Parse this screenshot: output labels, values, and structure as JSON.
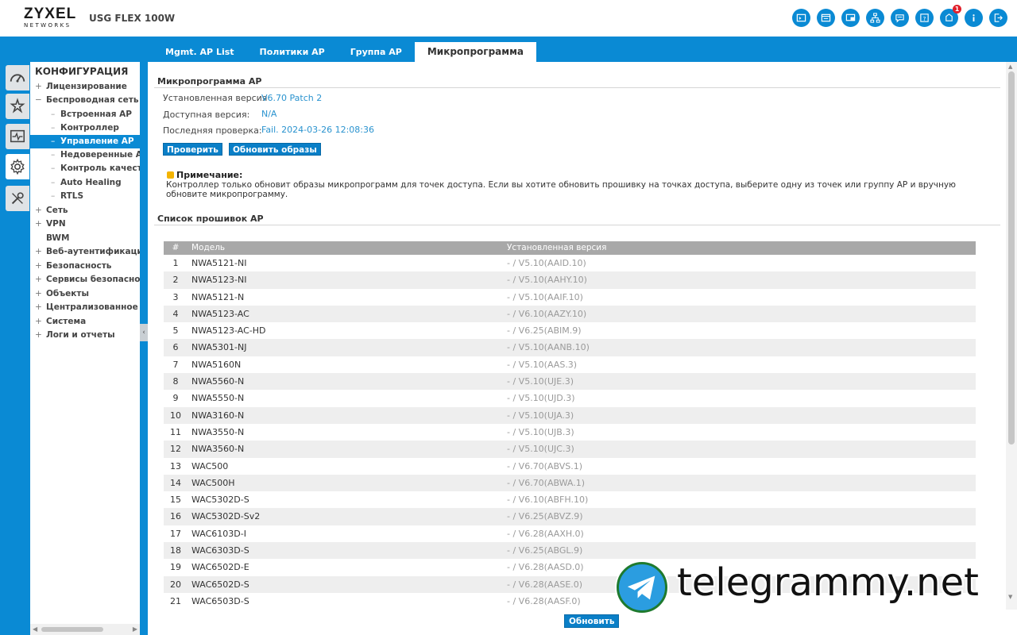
{
  "header": {
    "logo_main": "ZYXEL",
    "logo_sub": "NETWORKS",
    "device_name": "USG FLEX 100W",
    "notification_count": "1",
    "icons": [
      "console-icon",
      "cli-icon",
      "monitor-window-icon",
      "network-map-icon",
      "chat-icon",
      "help-icon",
      "notification-icon",
      "info-icon",
      "logout-icon"
    ]
  },
  "tabs": [
    {
      "label": "Mgmt. AP List"
    },
    {
      "label": "Политики AP"
    },
    {
      "label": "Группа AP"
    },
    {
      "label": "Микропрограмма"
    }
  ],
  "rail": [
    "dashboard-icon",
    "wizard-icon",
    "monitor-icon",
    "configuration-gear-icon",
    "maintenance-tools-icon"
  ],
  "nav": {
    "title": "КОНФИГУРАЦИЯ",
    "items": [
      {
        "pm": "+",
        "label": "Лицензирование"
      },
      {
        "pm": "−",
        "label": "Беспроводная сеть"
      },
      {
        "pm": "+",
        "label": "Сеть"
      },
      {
        "pm": "+",
        "label": "VPN"
      },
      {
        "pm": "",
        "label": "BWM"
      },
      {
        "pm": "+",
        "label": "Веб-аутентификация"
      },
      {
        "pm": "+",
        "label": "Безопасность"
      },
      {
        "pm": "+",
        "label": "Сервисы безопасности"
      },
      {
        "pm": "+",
        "label": "Объекты"
      },
      {
        "pm": "+",
        "label": "Централизованное управление"
      },
      {
        "pm": "+",
        "label": "Система"
      },
      {
        "pm": "+",
        "label": "Логи и отчеты"
      }
    ],
    "subitems": [
      {
        "label": "Встроенная AP"
      },
      {
        "label": "Контроллер"
      },
      {
        "label": "Управление AP"
      },
      {
        "label": "Недоверенные AP"
      },
      {
        "label": "Контроль качества"
      },
      {
        "label": "Auto Healing"
      },
      {
        "label": "RTLS"
      }
    ]
  },
  "firmware": {
    "section_title": "Микропрограмма AP",
    "installed_label": "Установленная версия",
    "installed_value": "V6.70 Patch 2",
    "available_label": "Доступная версия:",
    "available_value": "N/A",
    "lastcheck_label": "Последняя проверка:",
    "lastcheck_value": "Fail. 2024-03-26 12:08:36",
    "check_button": "Проверить",
    "update_images_button": "Обновить образы",
    "note_title": "Примечание:",
    "note_text": "Контроллер только обновит образы микропрограмм для точек доступа. Если вы хотите обновить прошивку на точках доступа, выберите одну из точек или группу AP и вручную обновите микропрограмму."
  },
  "list": {
    "section_title": "Список прошивок AP",
    "columns": [
      "#",
      "Модель",
      "Установленная версия"
    ],
    "rows": [
      {
        "n": "1",
        "model": "NWA5121-NI",
        "version": "- / V5.10(AAID.10)"
      },
      {
        "n": "2",
        "model": "NWA5123-NI",
        "version": "- / V5.10(AAHY.10)"
      },
      {
        "n": "3",
        "model": "NWA5121-N",
        "version": "- / V5.10(AAIF.10)"
      },
      {
        "n": "4",
        "model": "NWA5123-AC",
        "version": "- / V6.10(AAZY.10)"
      },
      {
        "n": "5",
        "model": "NWA5123-AC-HD",
        "version": "- / V6.25(ABIM.9)"
      },
      {
        "n": "6",
        "model": "NWA5301-NJ",
        "version": "- / V5.10(AANB.10)"
      },
      {
        "n": "7",
        "model": "NWA5160N",
        "version": "- / V5.10(AAS.3)"
      },
      {
        "n": "8",
        "model": "NWA5560-N",
        "version": "- / V5.10(UJE.3)"
      },
      {
        "n": "9",
        "model": "NWA5550-N",
        "version": "- / V5.10(UJD.3)"
      },
      {
        "n": "10",
        "model": "NWA3160-N",
        "version": "- / V5.10(UJA.3)"
      },
      {
        "n": "11",
        "model": "NWA3550-N",
        "version": "- / V5.10(UJB.3)"
      },
      {
        "n": "12",
        "model": "NWA3560-N",
        "version": "- / V5.10(UJC.3)"
      },
      {
        "n": "13",
        "model": "WAC500",
        "version": "- / V6.70(ABVS.1)"
      },
      {
        "n": "14",
        "model": "WAC500H",
        "version": "- / V6.70(ABWA.1)"
      },
      {
        "n": "15",
        "model": "WAC5302D-S",
        "version": "- / V6.10(ABFH.10)"
      },
      {
        "n": "16",
        "model": "WAC5302D-Sv2",
        "version": "- / V6.25(ABVZ.9)"
      },
      {
        "n": "17",
        "model": "WAC6103D-I",
        "version": "- / V6.28(AAXH.0)"
      },
      {
        "n": "18",
        "model": "WAC6303D-S",
        "version": "- / V6.25(ABGL.9)"
      },
      {
        "n": "19",
        "model": "WAC6502D-E",
        "version": "- / V6.28(AASD.0)"
      },
      {
        "n": "20",
        "model": "WAC6502D-S",
        "version": "- / V6.28(AASE.0)"
      },
      {
        "n": "21",
        "model": "WAC6503D-S",
        "version": "- / V6.28(AASF.0)"
      }
    ]
  },
  "footer": {
    "apply_button": "Обновить"
  },
  "watermark": {
    "text": "telegrammy.net"
  },
  "colors": {
    "accent": "#0a8ad4",
    "link": "#2a93cf",
    "header_gray": "#a8a8a8"
  }
}
